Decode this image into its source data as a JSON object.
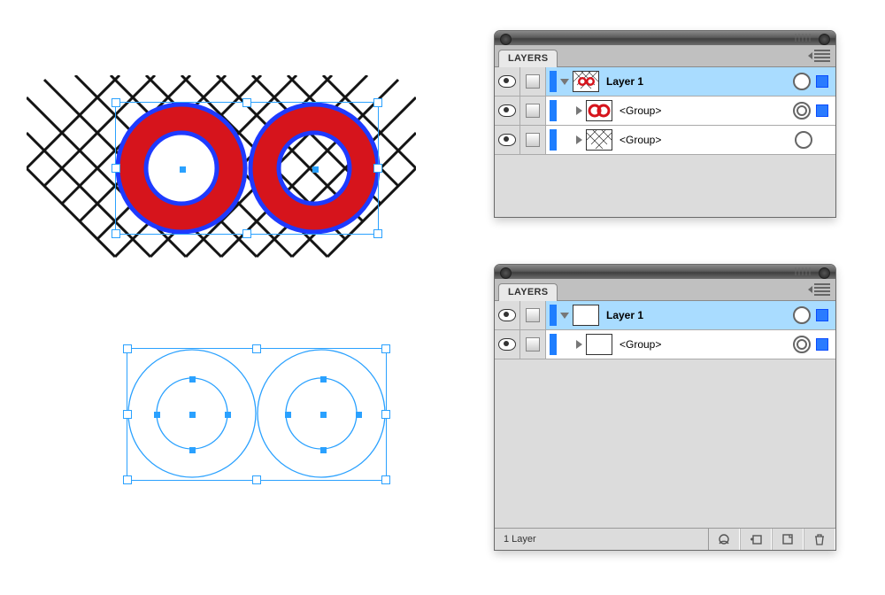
{
  "panels": [
    {
      "title": "LAYERS",
      "rows": [
        {
          "name": "Layer 1",
          "bold": true,
          "highlight": true,
          "expand": "down",
          "indent": 0,
          "thumb": "hatch-rings",
          "target": "single",
          "chip": "solid"
        },
        {
          "name": "<Group>",
          "bold": false,
          "highlight": false,
          "expand": "right",
          "indent": 1,
          "thumb": "rings-red",
          "target": "double",
          "chip": "solid"
        },
        {
          "name": "<Group>",
          "bold": false,
          "highlight": false,
          "expand": "right",
          "indent": 1,
          "thumb": "hatch",
          "target": "single",
          "chip": "none"
        }
      ],
      "footer_status": null
    },
    {
      "title": "LAYERS",
      "rows": [
        {
          "name": "Layer 1",
          "bold": true,
          "highlight": true,
          "expand": "down",
          "indent": 0,
          "thumb": "white",
          "target": "single",
          "chip": "solid"
        },
        {
          "name": "<Group>",
          "bold": false,
          "highlight": false,
          "expand": "right",
          "indent": 1,
          "thumb": "white",
          "target": "double",
          "chip": "solid"
        }
      ],
      "footer_status": "1 Layer"
    }
  ],
  "colors": {
    "selection_blue": "#2aa1ff",
    "ring_red": "#d6141c",
    "ring_stroke_blue": "#1e40ff"
  }
}
